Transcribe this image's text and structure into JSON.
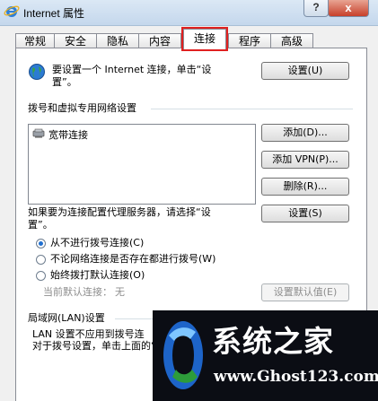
{
  "window": {
    "title": "Internet 属性",
    "help_label": "?",
    "close_label": "x"
  },
  "tabs": [
    {
      "label": "常规"
    },
    {
      "label": "安全"
    },
    {
      "label": "隐私"
    },
    {
      "label": "内容"
    },
    {
      "label": "连接",
      "selected": true
    },
    {
      "label": "程序"
    },
    {
      "label": "高级"
    }
  ],
  "setup": {
    "text_line1": "要设置一个 Internet 连接，单击“设",
    "text_line2": "置”。",
    "button": "设置(U)"
  },
  "dialup": {
    "heading": "拨号和虚拟专用网络设置",
    "connections": [
      {
        "label": "宽带连接"
      }
    ],
    "add_button": "添加(D)...",
    "add_vpn_button": "添加 VPN(P)...",
    "remove_button": "删除(R)...",
    "proxy_text_line1": "如果要为连接配置代理服务器，请选择“设",
    "proxy_text_line2": "置”。",
    "settings_button": "设置(S)",
    "options": [
      {
        "label": "从不进行拨号连接(C)",
        "checked": true
      },
      {
        "label": "不论网络连接是否存在都进行拨号(W)",
        "checked": false
      },
      {
        "label": "始终拨打默认连接(O)",
        "checked": false
      }
    ],
    "current_default_label": "当前默认连接：",
    "current_default_value": "无",
    "set_default_button": "设置默认值(E)"
  },
  "lan": {
    "heading": "局域网(LAN)设置",
    "text_line1": "LAN 设置不应用到拨号连",
    "text_line2": "对于拨号设置，单击上面的“设置”按"
  },
  "watermark": {
    "title": "系统之家",
    "url": "www.Ghost123.com"
  },
  "colors": {
    "highlight": "#e02020",
    "radio_dot": "#1f6fd0"
  }
}
